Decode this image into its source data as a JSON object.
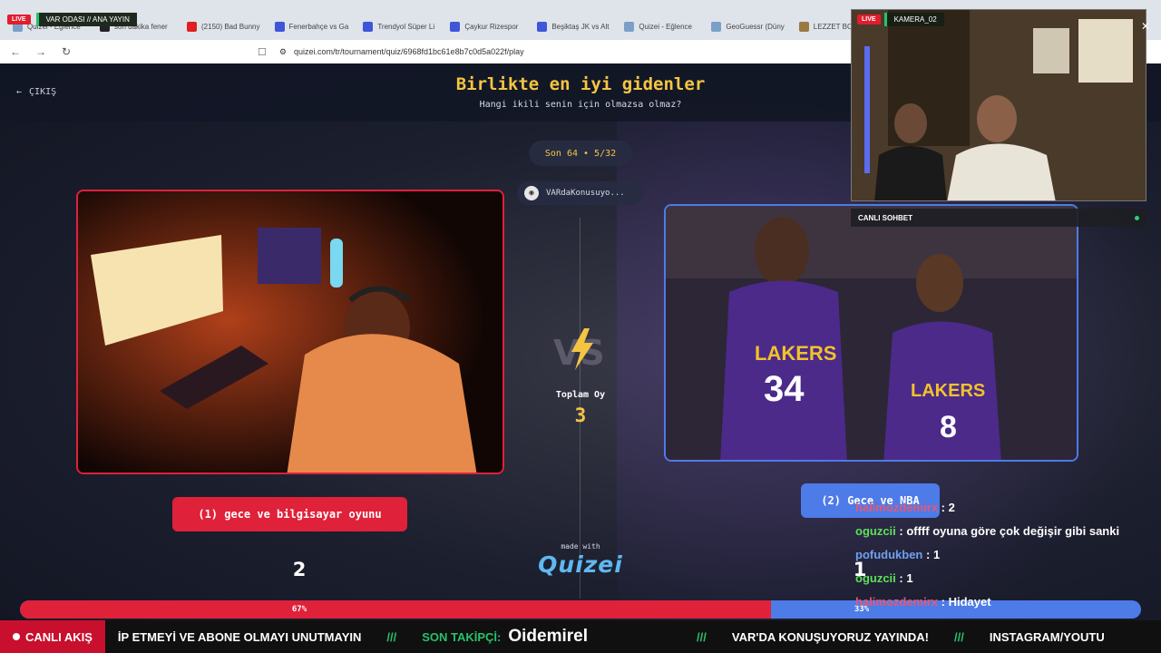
{
  "browser": {
    "tabs": [
      {
        "label": "Quizei - Eğlence",
        "color": "#7aa0c8"
      },
      {
        "label": "son dakika fener",
        "color": "#222222"
      },
      {
        "label": "(2150) Bad Bunny",
        "color": "#e02020"
      },
      {
        "label": "Fenerbahçe vs Ga",
        "color": "#4056d8"
      },
      {
        "label": "Trendyol Süper Li",
        "color": "#4056d8"
      },
      {
        "label": "Çaykur Rizespor",
        "color": "#4056d8"
      },
      {
        "label": "Beşiktaş JK vs Alt",
        "color": "#4056d8"
      },
      {
        "label": "Quizei - Eğlence",
        "color": "#7aa0c8"
      },
      {
        "label": "GeoGuessr (Düny",
        "color": "#7aa0c8"
      },
      {
        "label": "LEZZET BOMBAL",
        "color": "#9a7a40"
      }
    ],
    "overlay_live": "LIVE",
    "overlay_title": "VAR ODASI // ANA YAYIN",
    "url": "quizei.com/tr/tournament/quiz/6968fd1bc61e8b7c0d5a022f/play"
  },
  "header": {
    "exit_label": "ÇIKIŞ",
    "title": "Birlikte en iyi gidenler",
    "subtitle": "Hangi ikili senin için olmazsa olmaz?"
  },
  "round": {
    "label": "Son 64 • 5/32",
    "creator": "VARdaKonusuyo..."
  },
  "options": {
    "left": {
      "label": "(1) gece ve bilgisayar oyunu",
      "votes": "2",
      "percent": "67%"
    },
    "right": {
      "label": "(2) Gece ve NBA",
      "votes": "1",
      "percent": "33%"
    }
  },
  "vs": {
    "text": "VS",
    "total_label": "Toplam Oy",
    "total_value": "3"
  },
  "brand": {
    "made_with": "made with",
    "name": "Quizei"
  },
  "progress": {
    "left_fraction": 0.67
  },
  "camera": {
    "live": "LIVE",
    "title": "KAMERA_02"
  },
  "chat": {
    "header": "CANLI SOHBET",
    "messages": [
      {
        "user": "halimozdemirx",
        "text": "2",
        "color": "#e05a7a"
      },
      {
        "user": "oguzcii",
        "text": "offff oyuna göre çok değişir gibi sanki",
        "color": "#5de05a"
      },
      {
        "user": "pofudukben",
        "text": "1",
        "color": "#6fa0f0"
      },
      {
        "user": "oguzcii",
        "text": "1",
        "color": "#5de05a"
      },
      {
        "user": "halimozdemirx",
        "text": "Hidayet",
        "color": "#e05a7a"
      }
    ]
  },
  "ticker": {
    "live_label": "CANLI AKIŞ",
    "item1": "İP ETMEYİ VE ABONE OLMAYI UNUTMAYIN",
    "sep": "///",
    "follower_label": "SON TAKİPÇİ:",
    "follower_name": "Oidemirel",
    "item2": "VAR'DA KONUŞUYORUZ YAYINDA!",
    "item3": "INSTAGRAM/YOUTU"
  }
}
